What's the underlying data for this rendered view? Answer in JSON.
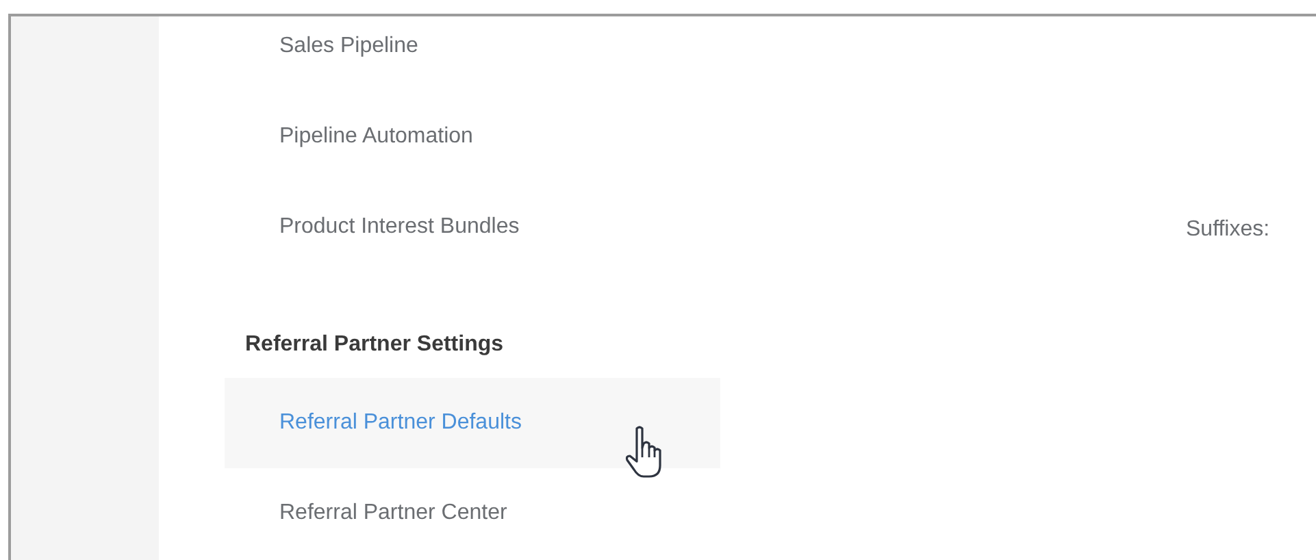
{
  "menu": [
    {
      "items": [
        {
          "label": "Sales Pipeline",
          "selected": false
        },
        {
          "label": "Pipeline Automation",
          "selected": false
        },
        {
          "label": "Product Interest Bundles",
          "selected": false
        }
      ]
    },
    {
      "heading": "Referral Partner Settings",
      "items": [
        {
          "label": "Referral Partner Defaults",
          "selected": true
        },
        {
          "label": "Referral Partner Center",
          "selected": false
        }
      ]
    }
  ],
  "side_label": "Suffixes:"
}
